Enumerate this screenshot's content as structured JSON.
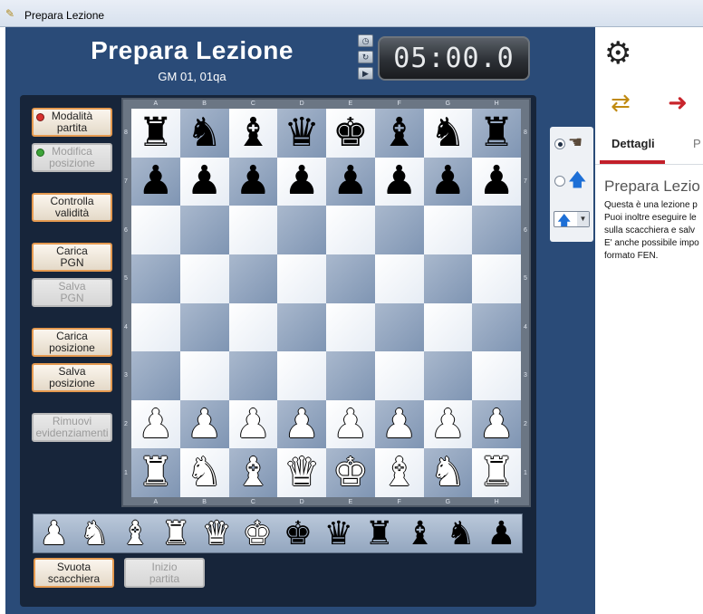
{
  "window": {
    "title": "Prepara Lezione"
  },
  "header": {
    "title": "Prepara Lezione",
    "subtitle": "GM 01, 01qa"
  },
  "clock": {
    "time": "05:00.0"
  },
  "left_buttons": [
    {
      "label1": "Modalità",
      "label2": "partita",
      "status_color": "#d8322e",
      "enabled": true
    },
    {
      "label1": "Modifica",
      "label2": "posizione",
      "status_color": "#3ea43a",
      "enabled": false
    },
    {
      "label1": "Controlla",
      "label2": "validità",
      "enabled": true
    },
    {
      "label1": "Carica",
      "label2": "PGN",
      "enabled": true
    },
    {
      "label1": "Salva",
      "label2": "PGN",
      "enabled": false
    },
    {
      "label1": "Carica",
      "label2": "posizione",
      "enabled": true
    },
    {
      "label1": "Salva",
      "label2": "posizione",
      "enabled": true
    },
    {
      "label1": "Rimuovi",
      "label2": "evidenziamenti",
      "enabled": false
    }
  ],
  "bottom_buttons": [
    {
      "label1": "Svuota",
      "label2": "scacchiera",
      "enabled": true
    },
    {
      "label1": "Inizio",
      "label2": "partita",
      "enabled": false
    }
  ],
  "board": {
    "files": [
      "A",
      "B",
      "C",
      "D",
      "E",
      "F",
      "G",
      "H"
    ],
    "ranks": [
      "8",
      "7",
      "6",
      "5",
      "4",
      "3",
      "2",
      "1"
    ],
    "position": [
      [
        "r",
        "n",
        "b",
        "q",
        "k",
        "b",
        "n",
        "r"
      ],
      [
        "p",
        "p",
        "p",
        "p",
        "p",
        "p",
        "p",
        "p"
      ],
      [
        "",
        "",
        "",
        "",
        "",
        "",
        "",
        ""
      ],
      [
        "",
        "",
        "",
        "",
        "",
        "",
        "",
        ""
      ],
      [
        "",
        "",
        "",
        "",
        "",
        "",
        "",
        ""
      ],
      [
        "",
        "",
        "",
        "",
        "",
        "",
        "",
        ""
      ],
      [
        "P",
        "P",
        "P",
        "P",
        "P",
        "P",
        "P",
        "P"
      ],
      [
        "R",
        "N",
        "B",
        "Q",
        "K",
        "B",
        "N",
        "R"
      ]
    ]
  },
  "piece_tray": [
    "P",
    "N",
    "B",
    "R",
    "Q",
    "K",
    "k",
    "q",
    "r",
    "b",
    "n",
    "p"
  ],
  "side_panel": {
    "selected_mode": "hand"
  },
  "right_panel": {
    "tabs": [
      "Dettagli",
      "P"
    ],
    "title": "Prepara Lezio",
    "body": [
      "Questa è una lezione p",
      "Puoi inoltre eseguire le",
      "sulla scacchiera e salv",
      "E' anche possibile impo",
      "formato FEN."
    ]
  }
}
